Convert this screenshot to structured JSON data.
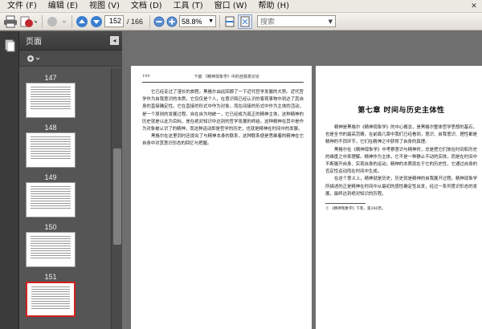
{
  "menu": {
    "items": [
      "文件 (F)",
      "编辑 (E)",
      "视图 (V)",
      "文档 (D)",
      "工具 (T)",
      "窗口 (W)",
      "帮助 (H)"
    ]
  },
  "toolbar": {
    "page_current": "152",
    "page_total": "/ 166",
    "zoom": "58.8%",
    "search_placeholder": "搜索"
  },
  "sidepanel": {
    "title": "页面",
    "thumbnails": [
      {
        "label": "147"
      },
      {
        "label": "148"
      },
      {
        "label": "149"
      },
      {
        "label": "150"
      },
      {
        "label": "151"
      }
    ]
  },
  "left_page": {
    "running_head_left": "190",
    "running_head_center": "下篇 《精神现象学》中的自我意识论",
    "paragraphs": [
      "它已经走过了漫长的旅程。黑格尔由此回顾了一下近代哲学发展的大势。近代哲学作为自我意识的本质，它仅仅是个人，在意识和已经认识的客观事物中到达了其自身的直接确定性。它在直接的形式中作为对象，而在间接的形式中作为主体的活动，是一个原则的发展过程。自在自为地统一，它已经成为真正的精神主体，这种精神的历史就是以此为目标，是在绝对知识中达到的哲学发展的终结。这种精神在其中是作为对象被认识了的精神，而这种运动即是哲学的历史，也就是精神在时间中的发展。",
      "黑格尔在这里同时还提出了与精神本身的联系，这种联系便是思维着的精神在它自身中对其意识形态的回忆与把握。"
    ]
  },
  "right_page": {
    "chapter_title": "第七章  时间与历史主体性",
    "paragraphs": [
      "精神是黑格尔《精神现象学》的中心概念，是黑格尔整体哲学思想的基石，也是全书的最高范畴。在前面几章中我们已经看到，意识、自我意识、理性都是精神的不同环节，它们在精神之中获得了自身的真理。",
      "黑格尔在《精神现象学》中考察意识与精神时，总是把它们放在时间和历史的维度之中来理解。精神作为主体，它不是一种静止不动的实体，而是在时间中不断展开自身、实现自身的运动。精神的本质就在于它的历史性，它通过自身的否定性运动而在时间中生成。",
      "在这个意义上，精神就是历史，历史就是精神的自我展开过程。精神现象学所描述的正是精神在时间中从最初的感性确定性出发，经过一系列意识形态的发展，最终达到绝对知识的历程。"
    ],
    "footnote": "① 《精神现象学》下卷，第266页。"
  }
}
